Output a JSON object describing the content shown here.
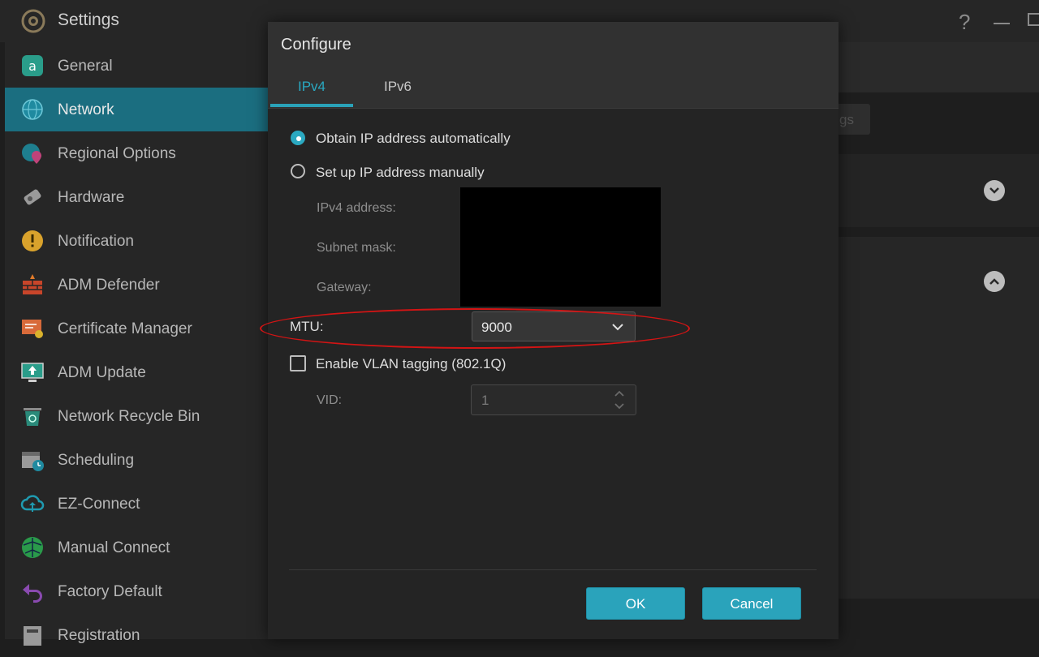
{
  "app": {
    "title": "Settings",
    "icon": "gear-icon",
    "help_symbol": "?"
  },
  "sidebar": {
    "items": [
      {
        "label": "General",
        "icon": "general-icon",
        "active": false
      },
      {
        "label": "Network",
        "icon": "globe-icon",
        "active": true
      },
      {
        "label": "Regional Options",
        "icon": "globe-pin-icon",
        "active": false
      },
      {
        "label": "Hardware",
        "icon": "hardware-icon",
        "active": false
      },
      {
        "label": "Notification",
        "icon": "alert-icon",
        "active": false
      },
      {
        "label": "ADM Defender",
        "icon": "firewall-icon",
        "active": false
      },
      {
        "label": "Certificate Manager",
        "icon": "certificate-icon",
        "active": false
      },
      {
        "label": "ADM Update",
        "icon": "update-icon",
        "active": false
      },
      {
        "label": "Network Recycle Bin",
        "icon": "recycle-bin-icon",
        "active": false
      },
      {
        "label": "Scheduling",
        "icon": "calendar-clock-icon",
        "active": false
      },
      {
        "label": "EZ-Connect",
        "icon": "cloud-upload-icon",
        "active": false
      },
      {
        "label": "Manual Connect",
        "icon": "network-ball-icon",
        "active": false
      },
      {
        "label": "Factory Default",
        "icon": "undo-arrow-icon",
        "active": false
      },
      {
        "label": "Registration",
        "icon": "registration-icon",
        "active": false
      }
    ]
  },
  "background": {
    "button_text": "gs"
  },
  "dialog": {
    "title": "Configure",
    "tabs": [
      {
        "label": "IPv4",
        "active": true
      },
      {
        "label": "IPv6",
        "active": false
      }
    ],
    "options": {
      "auto_label": "Obtain IP address automatically",
      "manual_label": "Set up IP address manually",
      "selected": "auto"
    },
    "fields": {
      "ipv4_label": "IPv4 address:",
      "subnet_label": "Subnet mask:",
      "gateway_label": "Gateway:"
    },
    "mtu": {
      "label": "MTU:",
      "value": "9000"
    },
    "vlan": {
      "label": "Enable VLAN tagging (802.1Q)",
      "checked": false
    },
    "vid": {
      "label": "VID:",
      "value": "1"
    },
    "buttons": {
      "ok": "OK",
      "cancel": "Cancel"
    }
  },
  "colors": {
    "accent": "#2aa3bb",
    "sidebar_active": "#1b6e80",
    "highlight": "#d41414"
  }
}
